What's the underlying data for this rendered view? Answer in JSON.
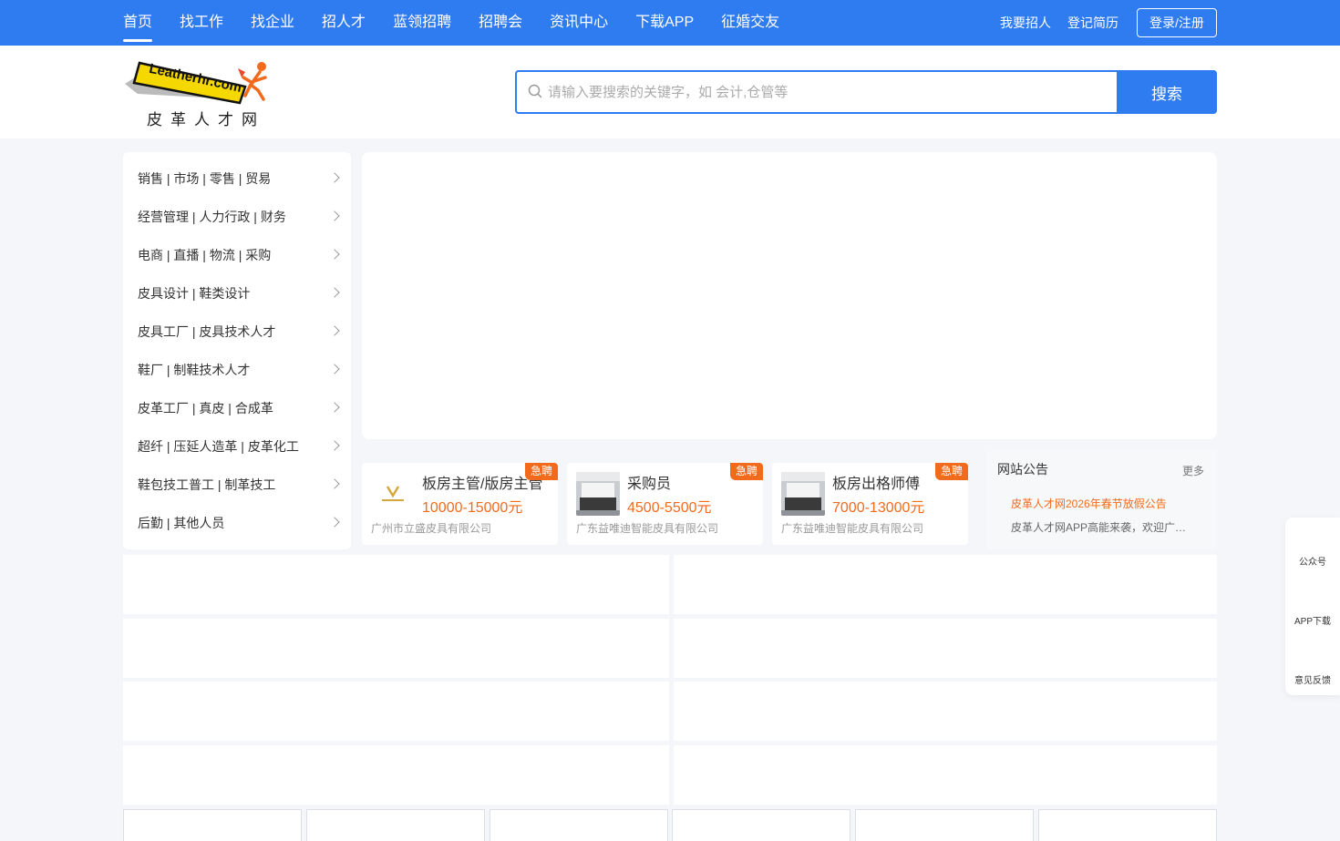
{
  "nav": {
    "items": [
      {
        "label": "首页",
        "active": true
      },
      {
        "label": "找工作"
      },
      {
        "label": "找企业"
      },
      {
        "label": "招人才"
      },
      {
        "label": "蓝领招聘"
      },
      {
        "label": "招聘会"
      },
      {
        "label": "资讯中心"
      },
      {
        "label": "下载APP"
      },
      {
        "label": "征婚交友"
      }
    ],
    "recruit_link": "我要招人",
    "resume_link": "登记简历",
    "login_button": "登录/注册"
  },
  "header": {
    "logo_text": "Leatherhr.com",
    "logo_cn": "皮革人才网",
    "search_placeholder": "请输入要搜索的关键字，如 会计,仓管等",
    "search_button": "搜索"
  },
  "categories": [
    "销售 | 市场 | 零售 | 贸易",
    "经营管理 | 人力行政 | 财务",
    "电商 | 直播 | 物流 | 采购",
    "皮具设计 | 鞋类设计",
    "皮具工厂 | 皮具技术人才",
    "鞋厂 | 制鞋技术人才",
    "皮革工厂 | 真皮 | 合成革",
    "超纤 | 压延人造革 | 皮革化工",
    "鞋包技工普工 | 制革技工",
    "后勤 | 其他人员"
  ],
  "urgent_jobs": [
    {
      "title": "板房主管/版房主管",
      "salary": "10000-15000元",
      "company": "广州市立盛皮具有限公司",
      "badge": "急聘"
    },
    {
      "title": "采购员",
      "salary": "4500-5500元",
      "company": "广东益唯迪智能皮具有限公司",
      "badge": "急聘"
    },
    {
      "title": "板房出格师傅",
      "salary": "7000-13000元",
      "company": "广东益唯迪智能皮具有限公司",
      "badge": "急聘"
    }
  ],
  "notice": {
    "title": "网站公告",
    "more": "更多",
    "items": [
      "皮革人才网2026年春节放假公告",
      "皮革人才网APP高能来袭，欢迎广大用户下载使用"
    ]
  },
  "float_bar": {
    "items": [
      "公众号",
      "APP下载",
      "意见反馈"
    ]
  },
  "colors": {
    "primary": "#2f7bf0",
    "accent": "#f26b1d",
    "background": "#f4f6fa"
  }
}
